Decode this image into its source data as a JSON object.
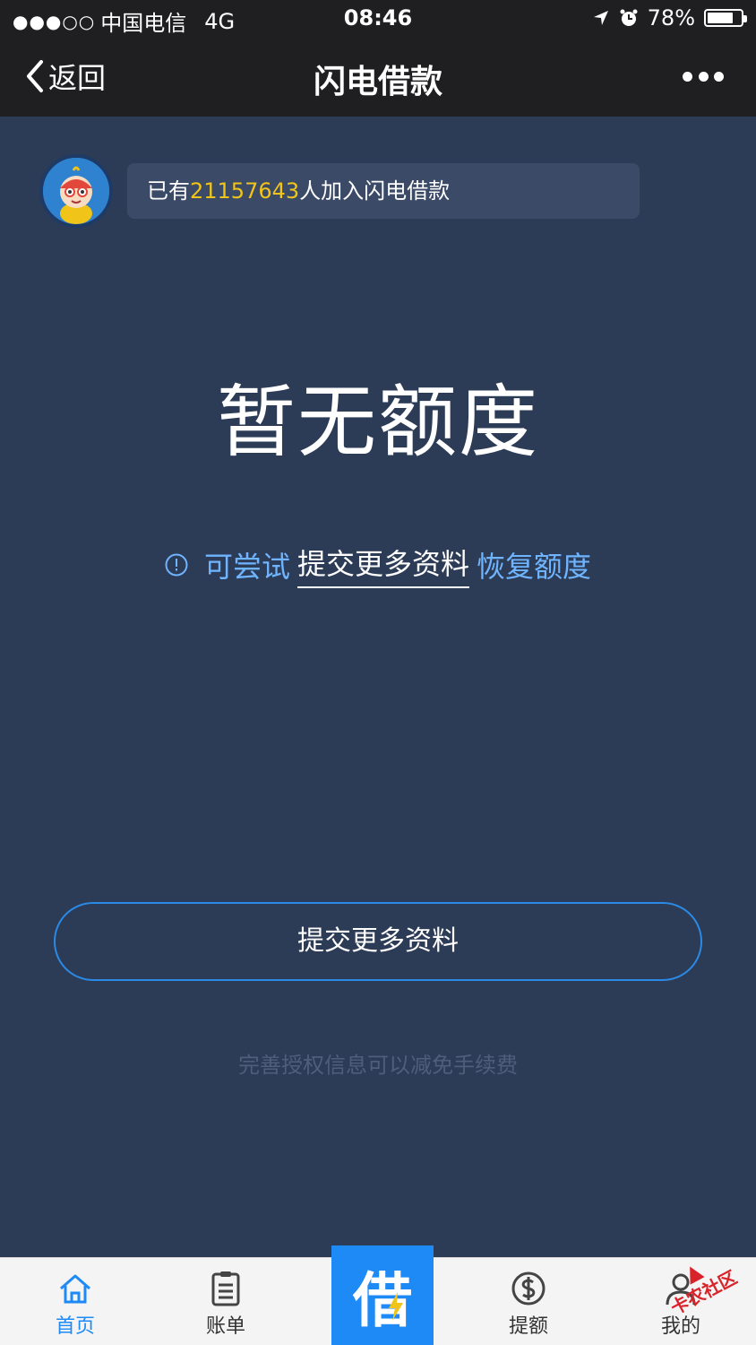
{
  "status_bar": {
    "signal": "●●●○○",
    "carrier": "中国电信",
    "network": "4G",
    "time": "08:46",
    "battery": "78%",
    "battery_level": 0.78
  },
  "nav": {
    "back_label": "返回",
    "title": "闪电借款"
  },
  "banner": {
    "prefix": "已有",
    "count": "21157643",
    "suffix": "人加入闪电借款"
  },
  "main": {
    "status_title": "暂无额度",
    "hint_prefix": "可尝试",
    "hint_link": "提交更多资料",
    "hint_suffix": "恢复额度",
    "submit_button": "提交更多资料",
    "footnote": "完善授权信息可以减免手续费"
  },
  "tabbar": {
    "home": "首页",
    "bill": "账单",
    "center": "借",
    "raise": "提额",
    "mine": "我的"
  },
  "watermark": "卡农社区",
  "colors": {
    "background": "#2c3b56",
    "bar": "#1f1f21",
    "accent": "#1e8af5",
    "count": "#f0c419",
    "hint": "#6fb4ff"
  }
}
